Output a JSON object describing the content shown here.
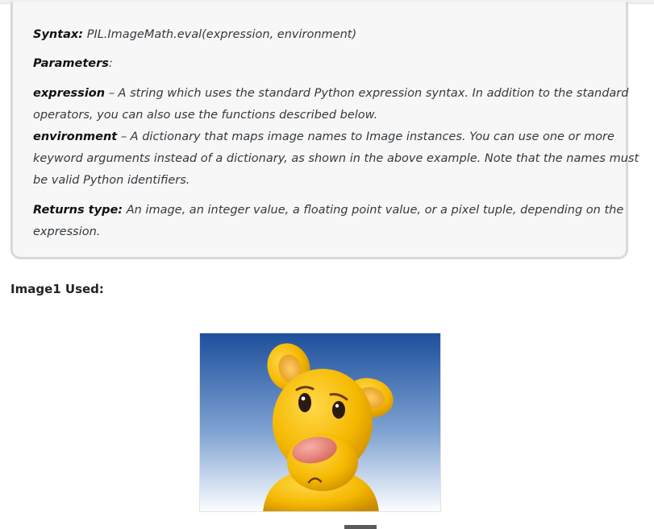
{
  "doc": {
    "syntax_label": "Syntax:",
    "syntax_value": "PIL.ImageMath.eval(expression, environment)",
    "parameters_label": "Parameters",
    "parameters_colon": ":",
    "params": [
      {
        "name": "expression",
        "desc_line1": "– A string which uses the standard Python expression syntax. In addition to the standard",
        "desc_line2": "operators, you can also use the functions described below."
      },
      {
        "name": "environment",
        "desc_line1": "– A dictionary that maps image names to Image instances. You can use one or more",
        "desc_line2": "keyword arguments instead of a dictionary, as shown in the above example. Note that the names must",
        "desc_line3": "be valid Python identifiers."
      }
    ],
    "returns_label": "Returns type:",
    "returns_line1": "An image, an integer value, a floating point value, or a pixel tuple, depending on the",
    "returns_line2": "expression."
  },
  "section": {
    "heading": "Image1 Used:"
  },
  "colors": {
    "box_bg": "#f7f7f7",
    "box_border": "#d7d9db",
    "sky_top": "#1e4f9c",
    "sky_bottom": "#ffffff",
    "character_yellow": "#f5b800",
    "nose_pink": "#e8857a"
  }
}
